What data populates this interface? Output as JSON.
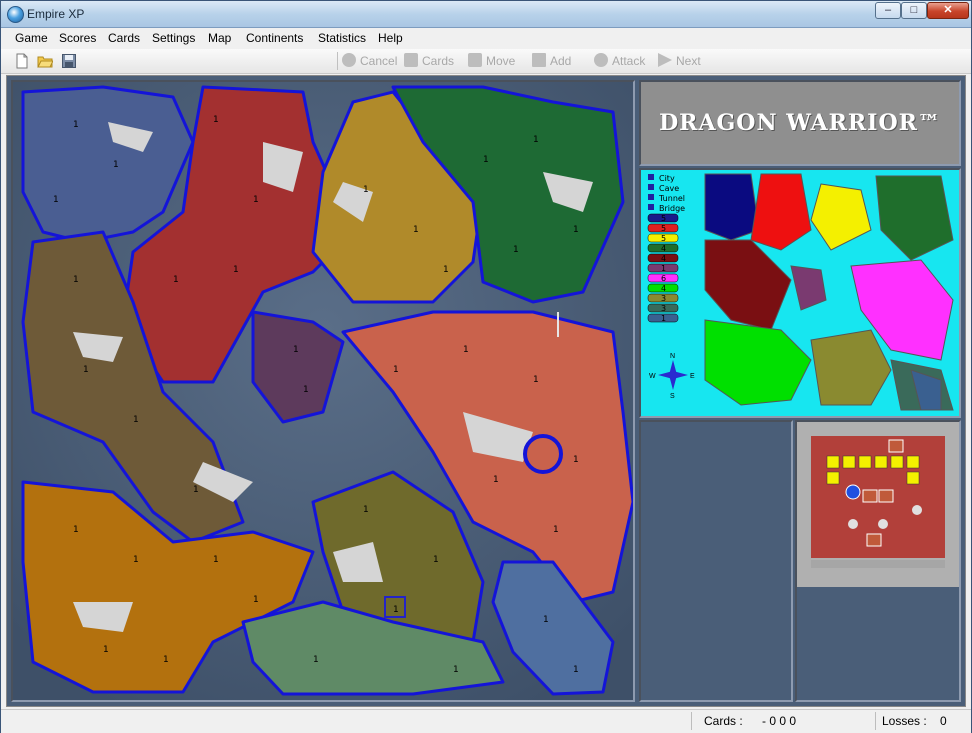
{
  "window": {
    "title": "Empire XP"
  },
  "menu": [
    "Game",
    "Scores",
    "Cards",
    "Settings",
    "Map",
    "Continents",
    "Statistics",
    "Help"
  ],
  "toolbar": {
    "actions": [
      "Cancel",
      "Cards",
      "Move",
      "Add",
      "Attack",
      "Next"
    ]
  },
  "map": {
    "territory_armies": "1",
    "legend": {
      "keys": [
        "City",
        "Cave",
        "Tunnel",
        "Bridge"
      ],
      "bonuses": [
        "5",
        "5",
        "5",
        "4",
        "4",
        "1",
        "6",
        "4",
        "3",
        "3",
        "1"
      ],
      "bonus_colors": [
        "#1a1a8a",
        "#e02020",
        "#f4f000",
        "#1f6e2c",
        "#7a0f12",
        "#7a3a70",
        "#ff30ff",
        "#00e000",
        "#8a8a30",
        "#3a6a5a",
        "#3a6090"
      ],
      "compass": [
        "N",
        "S",
        "W",
        "E"
      ]
    },
    "logo": "DRAGON WARRIOR™",
    "continent_colors": {
      "blue": "#4a5e92",
      "red": "#a33030",
      "yellow": "#b08a2a",
      "green": "#1e6a34",
      "brown": "#6e5a38",
      "purple": "#5d3a5c",
      "salmon": "#c9624c",
      "orange": "#b3710e",
      "olive": "#6f6a2c",
      "teal": "#5f8a66",
      "smallblue": "#4f6fa0",
      "water": "#4a5e78",
      "sand": "#d5d5d5",
      "border": "#1414d8"
    }
  },
  "status": {
    "cards_label": "Cards :",
    "cards_value": "- 0 0 0",
    "losses_label": "Losses :",
    "losses_value": "0"
  }
}
